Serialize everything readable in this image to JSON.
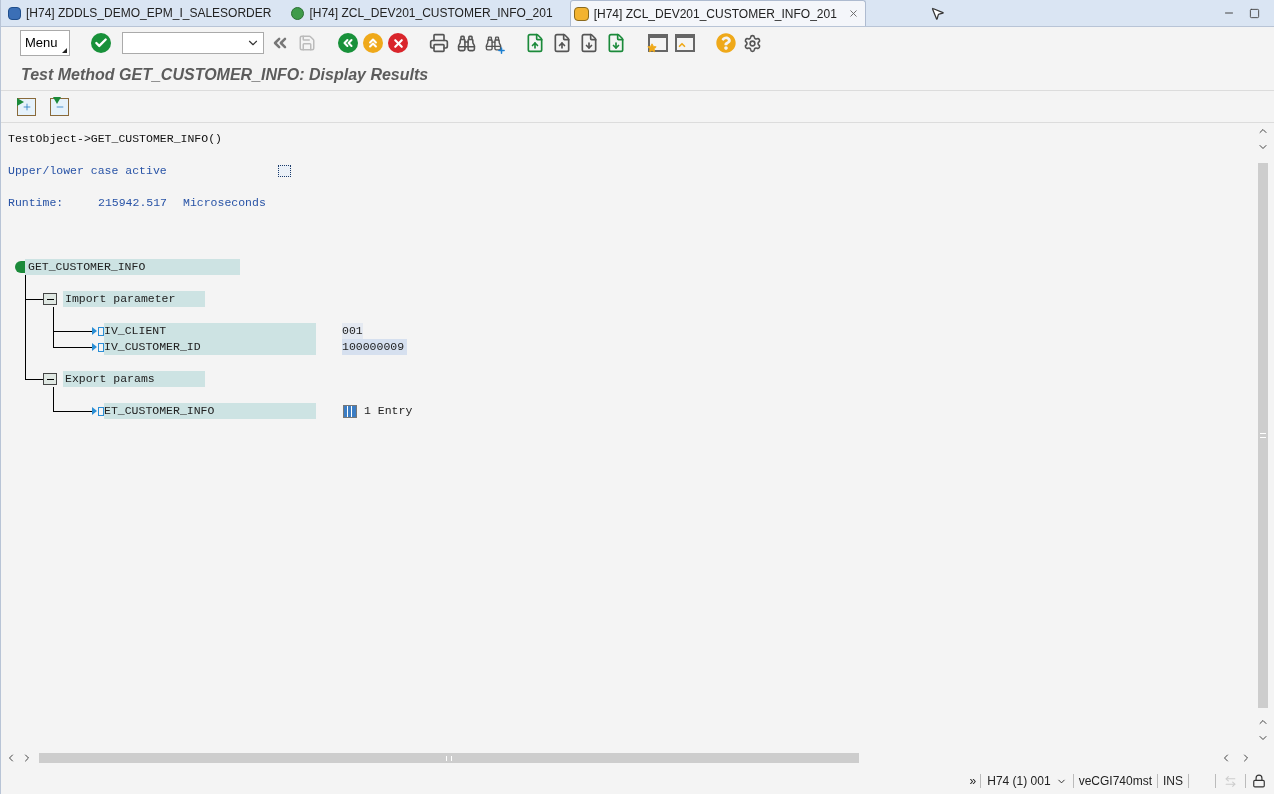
{
  "tabs": [
    {
      "label": "[H74] ZDDLS_DEMO_EPM_I_SALESORDER",
      "selected": false,
      "kind": "ddls"
    },
    {
      "label": "[H74] ZCL_DEV201_CUSTOMER_INFO_201",
      "selected": false,
      "kind": "class"
    },
    {
      "label": "[H74] ZCL_DEV201_CUSTOMER_INFO_201",
      "selected": true,
      "kind": "gui"
    }
  ],
  "toolbar": {
    "menu": "Menu"
  },
  "title": "Test Method GET_CUSTOMER_INFO: Display Results",
  "call": "TestObject->GET_CUSTOMER_INFO()",
  "case_option": {
    "label": "Upper/lower case active",
    "checked": false
  },
  "runtime": {
    "label": "Runtime:",
    "value": "215942.517",
    "unit": "Microseconds"
  },
  "tree": {
    "label": "GET_CUSTOMER_INFO",
    "children": [
      {
        "label": "Import parameter",
        "children": [
          {
            "label": "IV_CLIENT",
            "value": "001",
            "selected": false
          },
          {
            "label": "IV_CUSTOMER_ID",
            "value": "100000009",
            "selected": true
          }
        ]
      },
      {
        "label": "Export params",
        "children": [
          {
            "label": "ET_CUSTOMER_INFO",
            "value": "1 Entry",
            "selected": false,
            "kind": "table"
          }
        ]
      }
    ]
  },
  "status_bar": {
    "overflow": "»",
    "system": "H74 (1) 001",
    "server": "veCGI740mst",
    "mode": "INS"
  }
}
